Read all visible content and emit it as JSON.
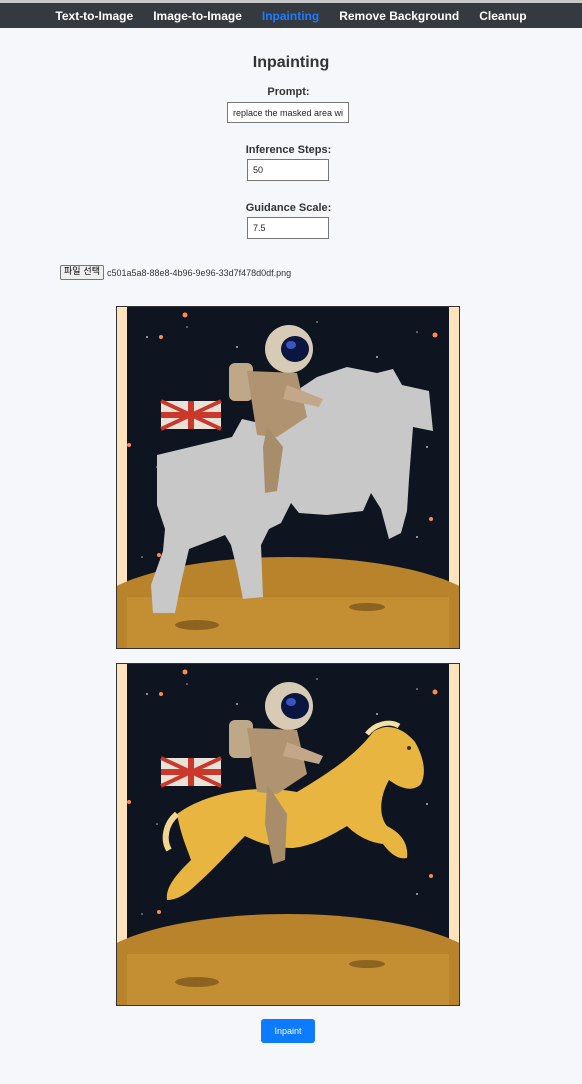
{
  "nav": {
    "items": [
      {
        "label": "Text-to-Image",
        "active": false
      },
      {
        "label": "Image-to-Image",
        "active": false
      },
      {
        "label": "Inpainting",
        "active": true
      },
      {
        "label": "Remove Background",
        "active": false
      },
      {
        "label": "Cleanup",
        "active": false
      }
    ],
    "active_color": "#1e7bff",
    "bar_color": "#343a40"
  },
  "page": {
    "title": "Inpainting"
  },
  "form": {
    "prompt_label": "Prompt:",
    "prompt_value": "replace the masked area wi",
    "steps_label": "Inference Steps:",
    "steps_value": "50",
    "guidance_label": "Guidance Scale:",
    "guidance_value": "7.5",
    "file_button": "파일 선택",
    "file_name": "c501a5a8-88e8-4b96-9e96-33d7f478d0df.png"
  },
  "images": {
    "masked_icon": "astronaut-masked-image",
    "result_icon": "astronaut-horse-result-image"
  },
  "action": {
    "button_label": "Inpaint",
    "button_color": "#0d7bff"
  }
}
